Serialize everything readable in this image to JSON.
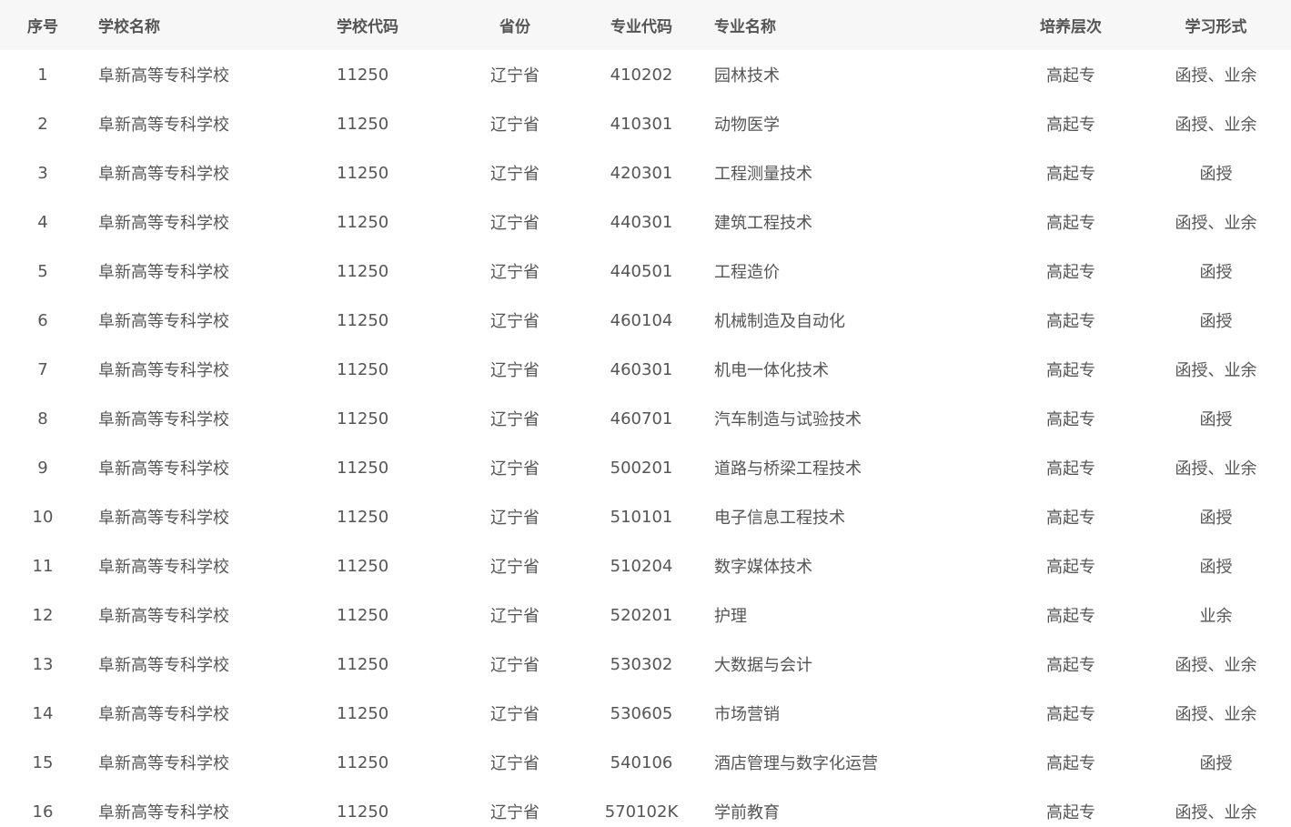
{
  "table": {
    "headers": [
      "序号",
      "学校名称",
      "学校代码",
      "省份",
      "专业代码",
      "专业名称",
      "培养层次",
      "学习形式"
    ],
    "rows": [
      [
        "1",
        "阜新高等专科学校",
        "11250",
        "辽宁省",
        "410202",
        "园林技术",
        "高起专",
        "函授、业余"
      ],
      [
        "2",
        "阜新高等专科学校",
        "11250",
        "辽宁省",
        "410301",
        "动物医学",
        "高起专",
        "函授、业余"
      ],
      [
        "3",
        "阜新高等专科学校",
        "11250",
        "辽宁省",
        "420301",
        "工程测量技术",
        "高起专",
        "函授"
      ],
      [
        "4",
        "阜新高等专科学校",
        "11250",
        "辽宁省",
        "440301",
        "建筑工程技术",
        "高起专",
        "函授、业余"
      ],
      [
        "5",
        "阜新高等专科学校",
        "11250",
        "辽宁省",
        "440501",
        "工程造价",
        "高起专",
        "函授"
      ],
      [
        "6",
        "阜新高等专科学校",
        "11250",
        "辽宁省",
        "460104",
        "机械制造及自动化",
        "高起专",
        "函授"
      ],
      [
        "7",
        "阜新高等专科学校",
        "11250",
        "辽宁省",
        "460301",
        "机电一体化技术",
        "高起专",
        "函授、业余"
      ],
      [
        "8",
        "阜新高等专科学校",
        "11250",
        "辽宁省",
        "460701",
        "汽车制造与试验技术",
        "高起专",
        "函授"
      ],
      [
        "9",
        "阜新高等专科学校",
        "11250",
        "辽宁省",
        "500201",
        "道路与桥梁工程技术",
        "高起专",
        "函授、业余"
      ],
      [
        "10",
        "阜新高等专科学校",
        "11250",
        "辽宁省",
        "510101",
        "电子信息工程技术",
        "高起专",
        "函授"
      ],
      [
        "11",
        "阜新高等专科学校",
        "11250",
        "辽宁省",
        "510204",
        "数字媒体技术",
        "高起专",
        "函授"
      ],
      [
        "12",
        "阜新高等专科学校",
        "11250",
        "辽宁省",
        "520201",
        "护理",
        "高起专",
        "业余"
      ],
      [
        "13",
        "阜新高等专科学校",
        "11250",
        "辽宁省",
        "530302",
        "大数据与会计",
        "高起专",
        "函授、业余"
      ],
      [
        "14",
        "阜新高等专科学校",
        "11250",
        "辽宁省",
        "530605",
        "市场营销",
        "高起专",
        "函授、业余"
      ],
      [
        "15",
        "阜新高等专科学校",
        "11250",
        "辽宁省",
        "540106",
        "酒店管理与数字化运营",
        "高起专",
        "函授"
      ],
      [
        "16",
        "阜新高等专科学校",
        "11250",
        "辽宁省",
        "570102K",
        "学前教育",
        "高起专",
        "函授、业余"
      ]
    ]
  },
  "colors": {
    "header_bg": "#f7f7f7",
    "text": "#555555",
    "background": "#ffffff"
  }
}
